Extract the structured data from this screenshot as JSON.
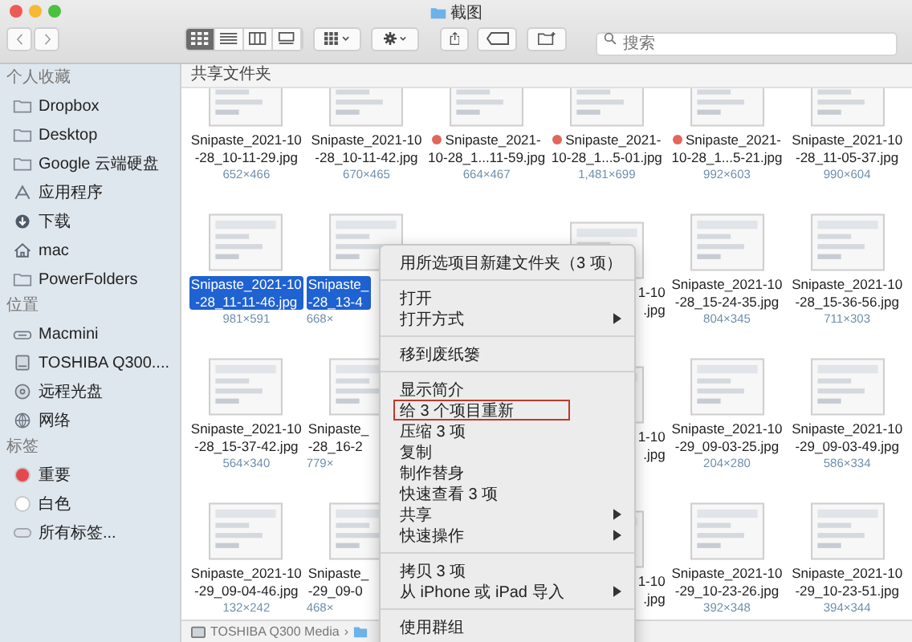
{
  "window": {
    "title": "截图"
  },
  "toolbar": {
    "view_buttons": [
      {
        "kind": "icons",
        "selected": true
      },
      {
        "kind": "list",
        "selected": false
      },
      {
        "kind": "columns",
        "selected": false
      },
      {
        "kind": "gallery",
        "selected": false
      }
    ],
    "search": {
      "placeholder": "搜索"
    }
  },
  "sidebar": {
    "sections": [
      {
        "title": "个人收藏",
        "items": [
          {
            "label": "Dropbox",
            "kind": "folder"
          },
          {
            "label": "Desktop",
            "kind": "folder"
          },
          {
            "label": "Google 云端硬盘",
            "kind": "folder"
          },
          {
            "label": "应用程序",
            "kind": "apps"
          },
          {
            "label": "下载",
            "kind": "download"
          },
          {
            "label": "mac",
            "kind": "home"
          },
          {
            "label": "PowerFolders",
            "kind": "folder"
          }
        ]
      },
      {
        "title": "位置",
        "items": [
          {
            "label": "Macmini",
            "kind": "computer"
          },
          {
            "label": "TOSHIBA Q300....",
            "kind": "disk"
          },
          {
            "label": "远程光盘",
            "kind": "disc"
          },
          {
            "label": "网络",
            "kind": "globe"
          }
        ]
      },
      {
        "title": "标签",
        "items": [
          {
            "label": "重要",
            "kind": "tag",
            "color": "#e5484d"
          },
          {
            "label": "白色",
            "kind": "tag",
            "color": "#ffffff"
          },
          {
            "label": "所有标签...",
            "kind": "alltags"
          }
        ]
      }
    ]
  },
  "content": {
    "header": "共享文件夹",
    "rows": [
      {
        "items": [
          {
            "kind": "full",
            "selected": false,
            "name": [
              "Snipaste_2021-10",
              "-28_10-11-29.jpg"
            ],
            "size": "652×466"
          },
          {
            "kind": "full",
            "selected": false,
            "name": [
              "Snipaste_2021-10",
              "-28_10-11-42.jpg"
            ],
            "size": "670×465"
          },
          {
            "kind": "full",
            "selected": false,
            "color": "#e0675a",
            "name": [
              "Snipaste_2021-",
              "10-28_1...11-59.jpg"
            ],
            "size": "664×467"
          },
          {
            "kind": "full",
            "selected": false,
            "color": "#e0675a",
            "name": [
              "Snipaste_2021-",
              "10-28_1...5-01.jpg"
            ],
            "size": "1,481×699"
          },
          {
            "kind": "full",
            "selected": false,
            "color": "#e0675a",
            "name": [
              "Snipaste_2021-",
              "10-28_1...5-21.jpg"
            ],
            "size": "992×603"
          },
          {
            "kind": "full",
            "selected": false,
            "name": [
              "Snipaste_2021-10",
              "-28_11-05-37.jpg"
            ],
            "size": "990×604"
          }
        ]
      },
      {
        "items": [
          {
            "kind": "full",
            "selected": true,
            "name": [
              "Snipaste_2021-10",
              "-28_11-11-46.jpg"
            ],
            "size": "981×591"
          },
          {
            "kind": "cut-right",
            "selected": true,
            "name": [
              "Snipaste_",
              "-28_13-4"
            ],
            "size": "668×"
          },
          {
            "kind": "covered"
          },
          {
            "kind": "cut-left",
            "selected": false,
            "name": [
              "1-10",
              ".jpg"
            ]
          },
          {
            "kind": "full",
            "selected": false,
            "name": [
              "Snipaste_2021-10",
              "-28_15-24-35.jpg"
            ],
            "size": "804×345"
          },
          {
            "kind": "full",
            "selected": false,
            "name": [
              "Snipaste_2021-10",
              "-28_15-36-56.jpg"
            ],
            "size": "711×303"
          }
        ]
      },
      {
        "items": [
          {
            "kind": "full",
            "selected": false,
            "name": [
              "Snipaste_2021-10",
              "-28_15-37-42.jpg"
            ],
            "size": "564×340"
          },
          {
            "kind": "cut-right",
            "selected": false,
            "name": [
              "Snipaste_",
              "-28_16-2"
            ],
            "size": "779×"
          },
          {
            "kind": "covered"
          },
          {
            "kind": "cut-left",
            "selected": false,
            "name": [
              "1-10",
              ".jpg"
            ]
          },
          {
            "kind": "full",
            "selected": false,
            "name": [
              "Snipaste_2021-10",
              "-29_09-03-25.jpg"
            ],
            "size": "204×280"
          },
          {
            "kind": "full",
            "selected": false,
            "name": [
              "Snipaste_2021-10",
              "-29_09-03-49.jpg"
            ],
            "size": "586×334"
          }
        ]
      },
      {
        "items": [
          {
            "kind": "full",
            "selected": false,
            "name": [
              "Snipaste_2021-10",
              "-29_09-04-46.jpg"
            ],
            "size": "132×242"
          },
          {
            "kind": "cut-right",
            "selected": false,
            "name": [
              "Snipaste_",
              "-29_09-0"
            ],
            "size": "468×"
          },
          {
            "kind": "covered"
          },
          {
            "kind": "cut-left",
            "selected": false,
            "name": [
              "1-10",
              ".jpg"
            ]
          },
          {
            "kind": "full",
            "selected": false,
            "name": [
              "Snipaste_2021-10",
              "-29_10-23-26.jpg"
            ],
            "size": "392×348"
          },
          {
            "kind": "full",
            "selected": false,
            "name": [
              "Snipaste_2021-10",
              "-29_10-23-51.jpg"
            ],
            "size": "394×344"
          }
        ]
      }
    ]
  },
  "path_bar": {
    "label": "TOSHIBA Q300 Media",
    "separator": "›"
  },
  "context_menu": {
    "groups": [
      {
        "items": [
          {
            "label": "用所选项目新建文件夹（3 项）",
            "submenu": false,
            "highlighted": false
          }
        ]
      },
      {
        "items": [
          {
            "label": "打开",
            "submenu": false,
            "highlighted": false
          },
          {
            "label": "打开方式",
            "submenu": true,
            "highlighted": false
          }
        ]
      },
      {
        "items": [
          {
            "label": "移到废纸篓",
            "submenu": false,
            "highlighted": false
          }
        ]
      },
      {
        "items": [
          {
            "label": "显示简介",
            "submenu": false,
            "highlighted": false
          },
          {
            "label": "给 3 个项目重新",
            "submenu": false,
            "highlighted": true
          },
          {
            "label": "压缩 3 项",
            "submenu": false,
            "highlighted": false
          },
          {
            "label": "复制",
            "submenu": false,
            "highlighted": false
          },
          {
            "label": "制作替身",
            "submenu": false,
            "highlighted": false
          },
          {
            "label": "快速查看 3 项",
            "submenu": false,
            "highlighted": false
          },
          {
            "label": "共享",
            "submenu": true,
            "highlighted": false
          },
          {
            "label": "快速操作",
            "submenu": true,
            "highlighted": false
          }
        ]
      },
      {
        "items": [
          {
            "label": "拷贝 3 项",
            "submenu": false,
            "highlighted": false
          },
          {
            "label": "从 iPhone 或 iPad 导入",
            "submenu": true,
            "highlighted": false
          }
        ]
      },
      {
        "items": [
          {
            "label": "使用群组",
            "submenu": false,
            "highlighted": false
          }
        ]
      }
    ]
  }
}
